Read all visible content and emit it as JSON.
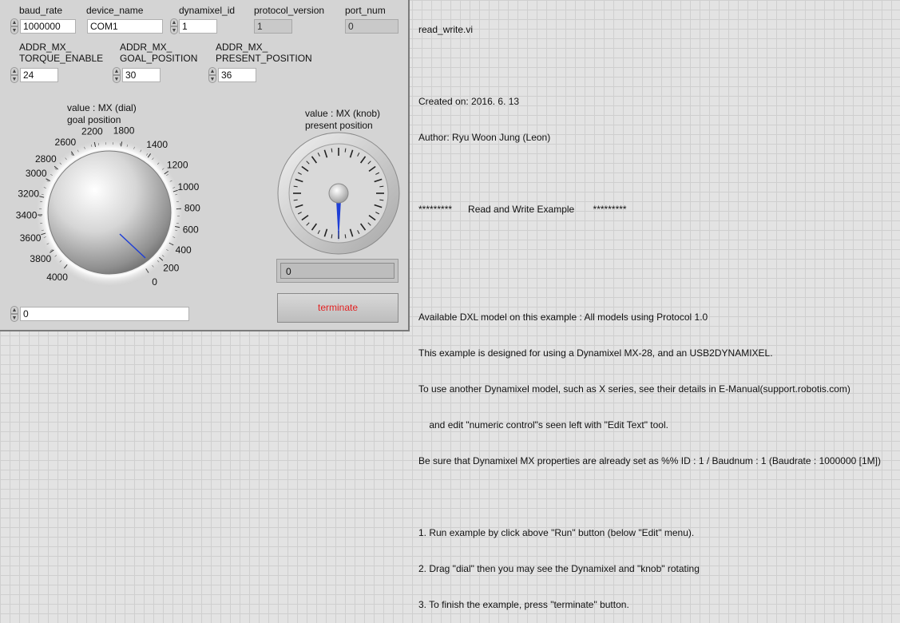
{
  "controls": {
    "baud_rate": {
      "label": "baud_rate",
      "value": "1000000"
    },
    "device_name": {
      "label": "device_name",
      "value": "COM1"
    },
    "dynamixel_id": {
      "label": "dynamixel_id",
      "value": "1"
    },
    "protocol_version": {
      "label": "protocol_version",
      "value": "1"
    },
    "port_num": {
      "label": "port_num",
      "value": "0"
    },
    "torque_enable": {
      "label1": "ADDR_MX_",
      "label2": "TORQUE_ENABLE",
      "value": "24"
    },
    "goal_position": {
      "label1": "ADDR_MX_",
      "label2": "GOAL_POSITION",
      "value": "30"
    },
    "present_position": {
      "label1": "ADDR_MX_",
      "label2": "PRESENT_POSITION",
      "value": "36"
    }
  },
  "dial": {
    "label1": "value : MX (dial)",
    "label2": "goal position",
    "ticks": [
      "0",
      "200",
      "400",
      "600",
      "800",
      "1000",
      "1200",
      "1400",
      "1800",
      "2200",
      "2600",
      "2800",
      "3000",
      "3200",
      "3400",
      "3600",
      "3800",
      "4000"
    ],
    "value": "0",
    "needle_value": 400
  },
  "knob": {
    "label1": "value : MX (knob)",
    "label2": "present position",
    "value": "0"
  },
  "terminate_label": "terminate",
  "notes": {
    "file": "read_write.vi",
    "created": "Created on: 2016. 6. 13",
    "author": "Author: Ryu Woon Jung (Leon)",
    "header": "*********      Read and Write Example       *********",
    "lines": [
      "Available DXL model on this example : All models using Protocol 1.0",
      "This example is designed for using a Dynamixel MX-28, and an USB2DYNAMIXEL.",
      "To use another Dynamixel model, such as X series, see their details in E-Manual(support.robotis.com)",
      "    and edit \"numeric control\"s seen left with \"Edit Text\" tool.",
      "Be sure that Dynamixel MX properties are already set as %% ID : 1 / Baudnum : 1 (Baudrate : 1000000 [1M])"
    ],
    "steps": [
      "1. Run example by click above \"Run\" button (below \"Edit\" menu).",
      "2. Drag \"dial\" then you may see the Dynamixel and \"knob\" rotating",
      "3. To finish the example, press \"terminate\" button."
    ]
  },
  "colors": {
    "needle": "#1f3fd6",
    "terminate_text": "#e32222"
  }
}
